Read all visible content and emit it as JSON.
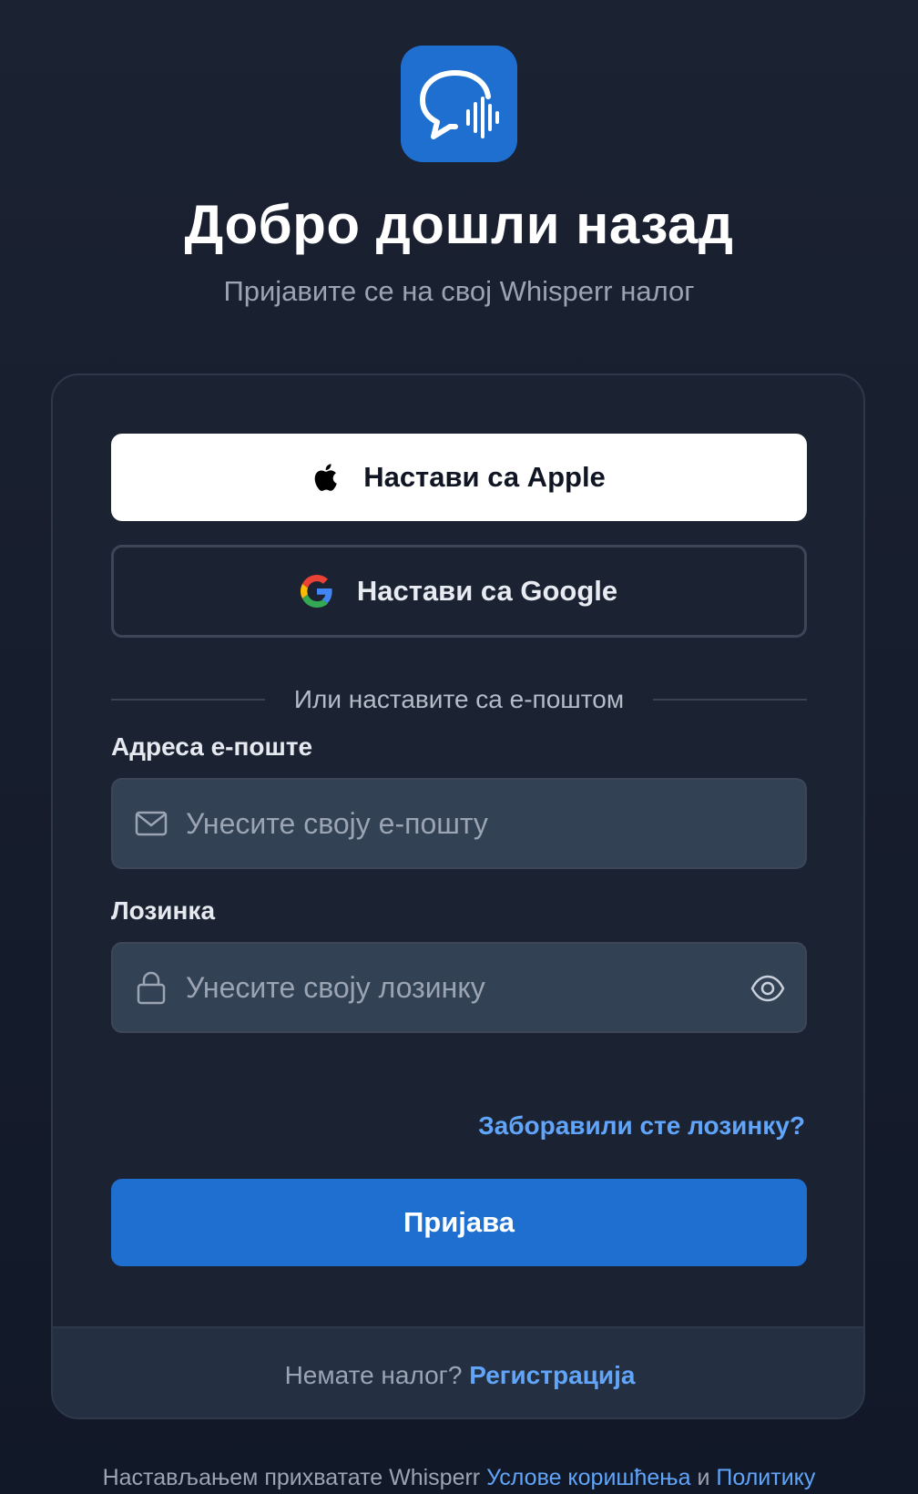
{
  "header": {
    "logo_icon": "chat-voice-icon",
    "title": "Добро дошли назад",
    "subtitle": "Пријавите се на свој Whisperr налог"
  },
  "social": {
    "apple_label": "Настави са Apple",
    "apple_icon": "apple-icon",
    "google_label": "Настави са Google",
    "google_icon": "google-icon"
  },
  "divider_text": "Или наставите са е-поштом",
  "email": {
    "label": "Адреса е-поште",
    "placeholder": "Унесите своју е-пошту",
    "value": "",
    "icon": "mail-icon"
  },
  "password": {
    "label": "Лозинка",
    "placeholder": "Унесите своју лозинку",
    "value": "",
    "icon": "lock-icon",
    "toggle_icon": "eye-icon"
  },
  "forgot_password": "Заборавили сте лозинку?",
  "submit_label": "Пријава",
  "footer": {
    "prompt": "Немате налог?",
    "register_link": "Регистрација"
  },
  "terms": {
    "prefix": "Настављањем прихватате Whisperr",
    "terms_link": "Услове коришћења",
    "conjunction": "и",
    "privacy_link": "Политику"
  },
  "colors": {
    "accent": "#1f6fd1",
    "link": "#60a5fa",
    "background": "#1b2232",
    "card": "#1b2333",
    "input": "#334155"
  }
}
